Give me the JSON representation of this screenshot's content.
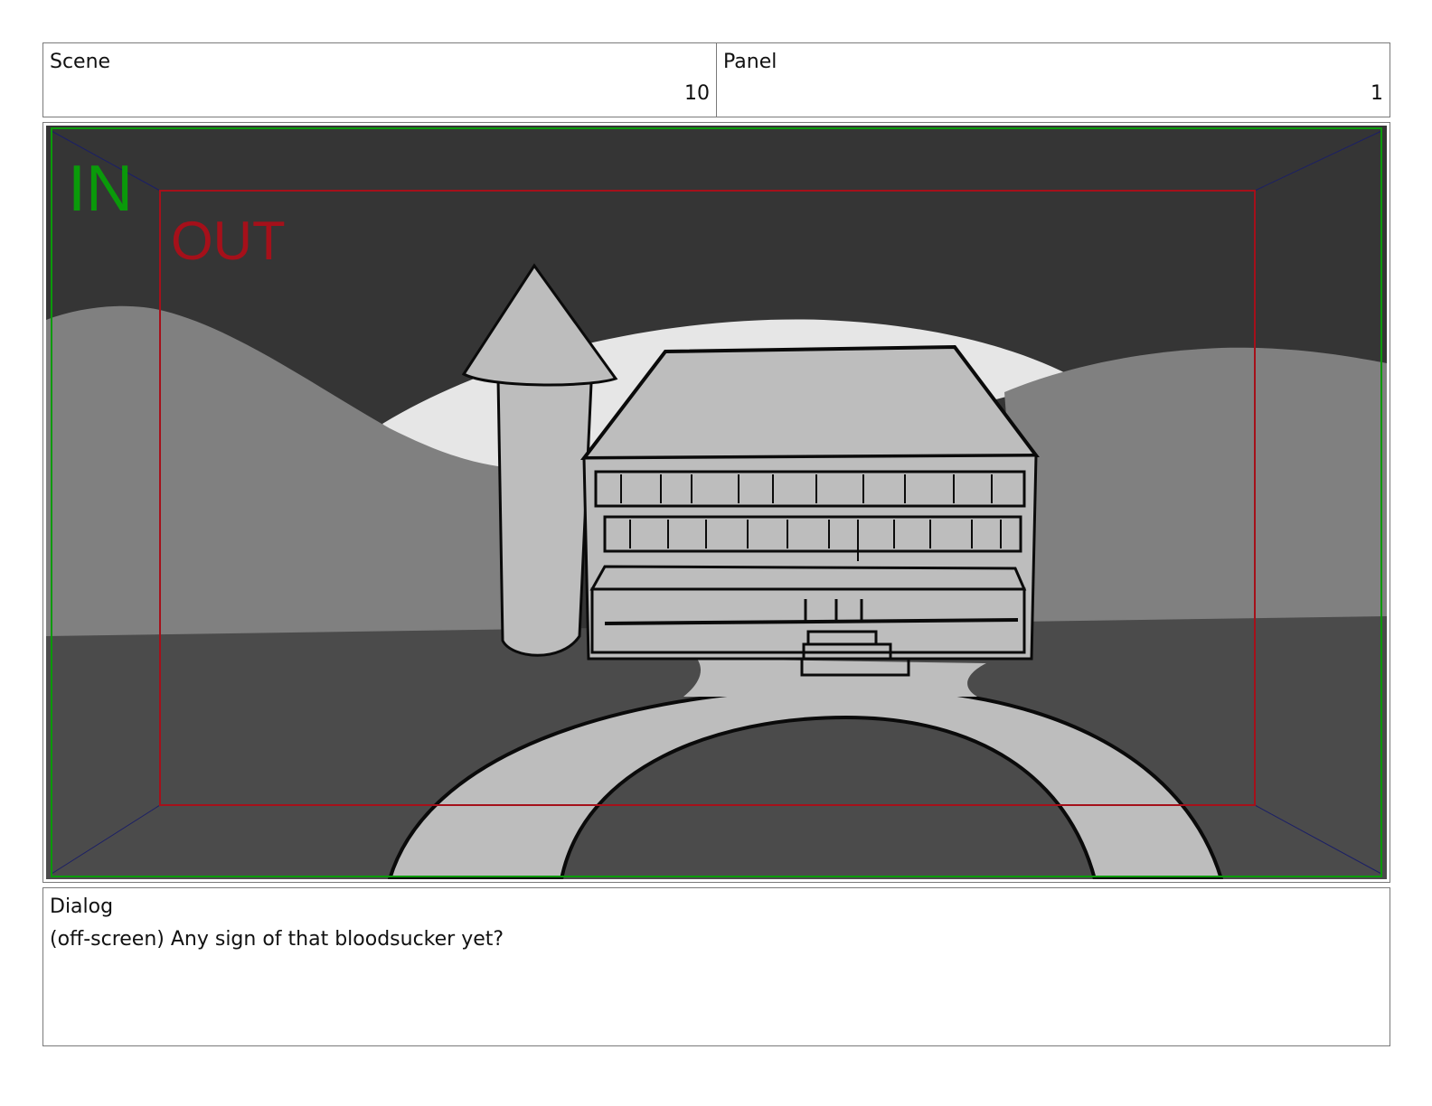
{
  "scene": {
    "label": "Scene",
    "value": "10"
  },
  "panel": {
    "label": "Panel",
    "value": "1"
  },
  "frame": {
    "in_label": "IN",
    "out_label": "OUT",
    "colors": {
      "in": "#0a9a0a",
      "out": "#a5101a",
      "sky": "#353535",
      "hills": "#808080",
      "ground": "#4b4b4b",
      "building": "#bdbdbd",
      "moon": "#e6e6e6",
      "ink": "#0a0a0a"
    }
  },
  "dialog": {
    "label": "Dialog",
    "text": "(off-screen) Any sign of that bloodsucker yet?"
  }
}
